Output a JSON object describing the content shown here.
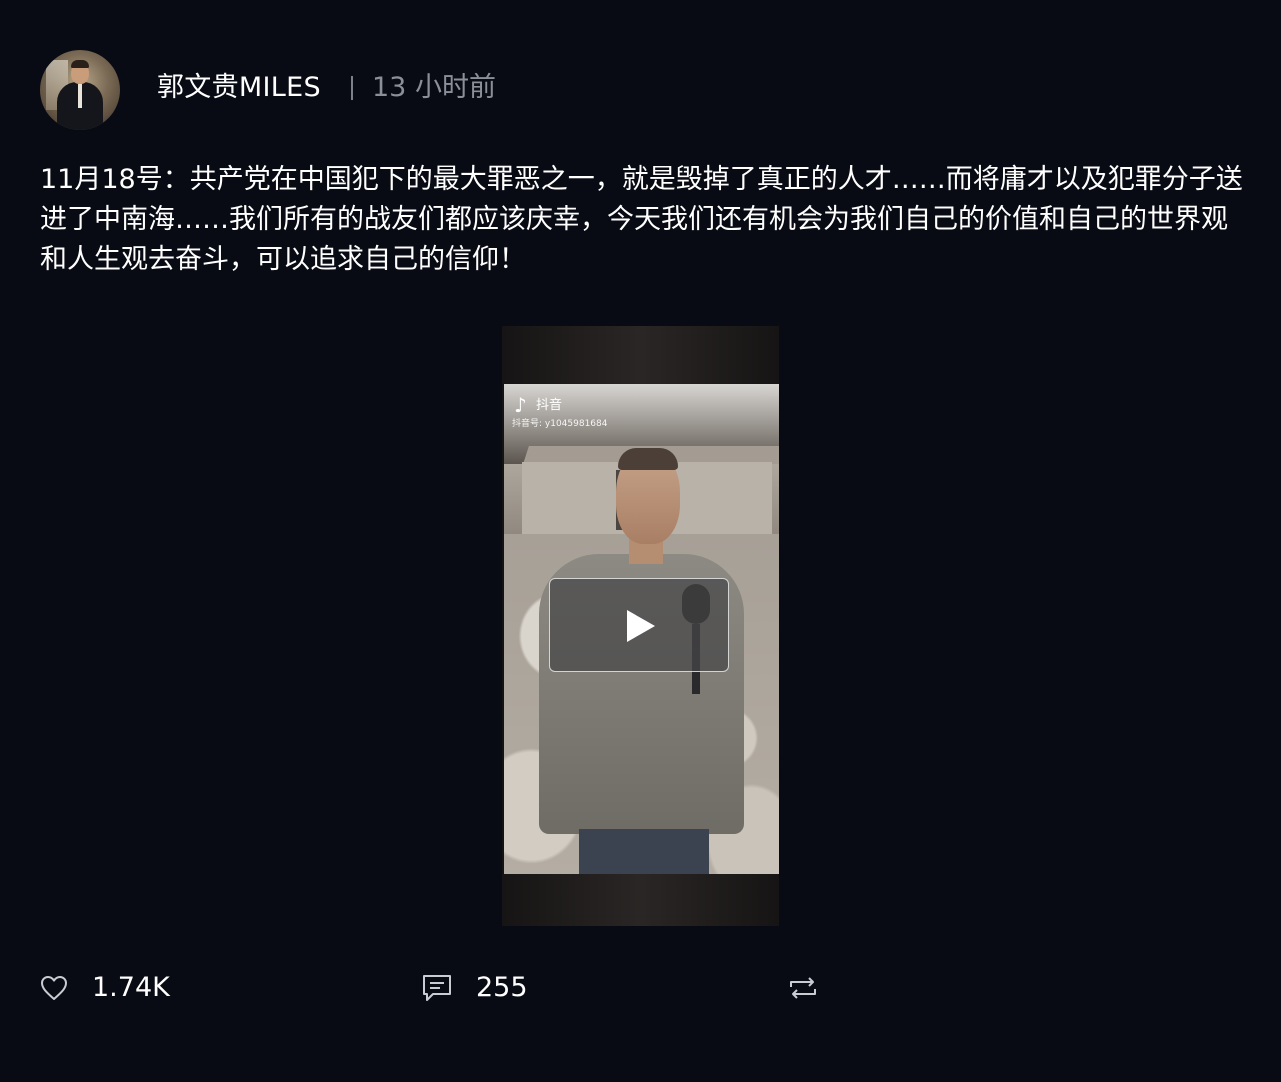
{
  "post": {
    "author": "郭文贵MILES",
    "time_ago": "13 小时前",
    "text": "11月18号：共产党在中国犯下的最大罪恶之一，就是毁掉了真正的人才……而将庸才以及犯罪分子送进了中南海……我们所有的战友们都应该庆幸，今天我们还有机会为我们自己的价值和自己的世界观和人生观去奋斗，可以追求自己的信仰！"
  },
  "video": {
    "watermark_app": "抖音",
    "watermark_id": "抖音号: y1045981684",
    "play_icon": "play-icon"
  },
  "actions": {
    "likes": "1.74K",
    "comments": "255",
    "like_icon": "heart-icon",
    "comment_icon": "comment-icon",
    "repost_icon": "repost-icon"
  },
  "colors": {
    "background": "#080b14",
    "text": "#ffffff",
    "muted": "#8b8f98"
  }
}
